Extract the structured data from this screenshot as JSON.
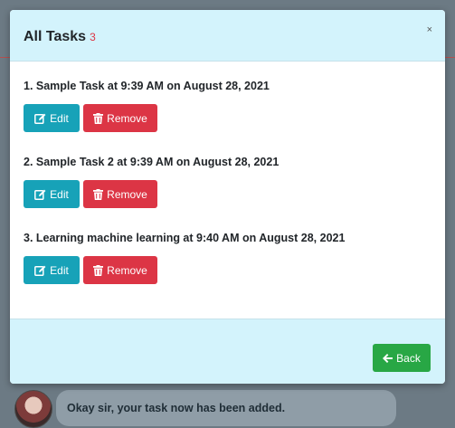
{
  "modal": {
    "title": "All Tasks",
    "count": "3",
    "close_symbol": "×"
  },
  "tasks": [
    {
      "title": "1. Sample Task at 9:39 AM on August 28, 2021",
      "edit_label": "Edit",
      "remove_label": "Remove"
    },
    {
      "title": "2. Sample Task 2 at 9:39 AM on August 28, 2021",
      "edit_label": "Edit",
      "remove_label": "Remove"
    },
    {
      "title": "3. Learning machine learning at 9:40 AM on August 28, 2021",
      "edit_label": "Edit",
      "remove_label": "Remove"
    }
  ],
  "footer": {
    "back_label": "Back"
  },
  "background_chat": {
    "message": "Okay sir, your task now has been added."
  },
  "colors": {
    "header_bg": "#d3f3fc",
    "edit": "#17a2b8",
    "remove": "#dc3545",
    "back": "#28a745",
    "count": "#dc3545"
  },
  "icons": {
    "edit": "edit-icon",
    "remove": "trash-icon",
    "back": "arrow-left-icon",
    "close": "close-icon"
  }
}
